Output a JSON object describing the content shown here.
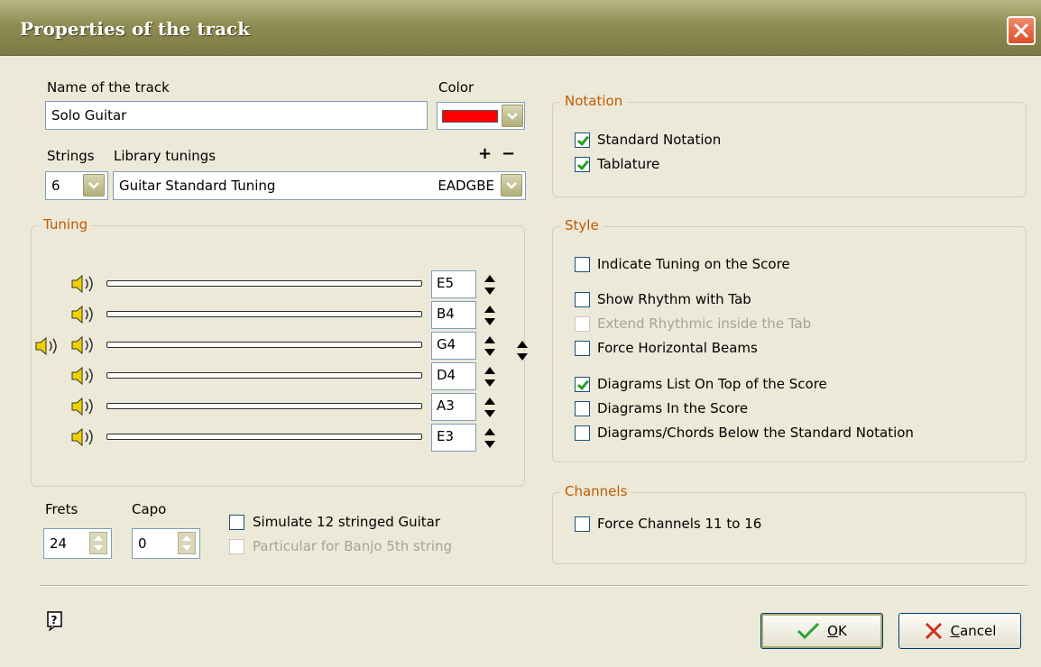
{
  "window": {
    "title": "Properties of the track"
  },
  "track": {
    "name_label": "Name of the track",
    "name_value": "Solo Guitar",
    "color_label": "Color",
    "color_value": "#ff0000",
    "strings_label": "Strings",
    "strings_value": "6",
    "library_label": "Library tunings",
    "add_symbol": "+",
    "remove_symbol": "−",
    "tuning_name": "Guitar Standard Tuning",
    "tuning_code": "EADGBE"
  },
  "tuning": {
    "title": "Tuning",
    "notes": [
      "E5",
      "B4",
      "G4",
      "D4",
      "A3",
      "E3"
    ]
  },
  "frets": {
    "label": "Frets",
    "value": "24"
  },
  "capo": {
    "label": "Capo",
    "value": "0"
  },
  "options": {
    "simulate12": {
      "label": "Simulate 12 stringed Guitar",
      "checked": false
    },
    "banjo": {
      "label": "Particular for Banjo 5th string",
      "checked": false,
      "disabled": true
    }
  },
  "notation": {
    "title": "Notation",
    "items": [
      {
        "label": "Standard Notation",
        "checked": true
      },
      {
        "label": "Tablature",
        "checked": true
      }
    ]
  },
  "style": {
    "title": "Style",
    "items": [
      {
        "label": "Indicate Tuning on the Score",
        "checked": false
      },
      {
        "label": "Show Rhythm with Tab",
        "checked": false
      },
      {
        "label": "Extend Rhythmic inside the Tab",
        "checked": false,
        "disabled": true
      },
      {
        "label": "Force Horizontal Beams",
        "checked": false
      },
      {
        "label": "Diagrams List On Top of the Score",
        "checked": true
      },
      {
        "label": "Diagrams In the Score",
        "checked": false
      },
      {
        "label": "Diagrams/Chords Below the Standard Notation",
        "checked": false
      }
    ]
  },
  "channels": {
    "title": "Channels",
    "items": [
      {
        "label": "Force Channels 11 to 16",
        "checked": false
      }
    ]
  },
  "buttons": {
    "ok_mnemonic": "O",
    "ok_rest": "K",
    "cancel_mnemonic": "C",
    "cancel_rest": "ancel"
  },
  "icons": {
    "help": "help-icon",
    "speaker": "speaker-icon",
    "updown": "up-down-arrows-icon",
    "check": "check-icon",
    "cross": "cross-icon",
    "close": "close-icon"
  }
}
